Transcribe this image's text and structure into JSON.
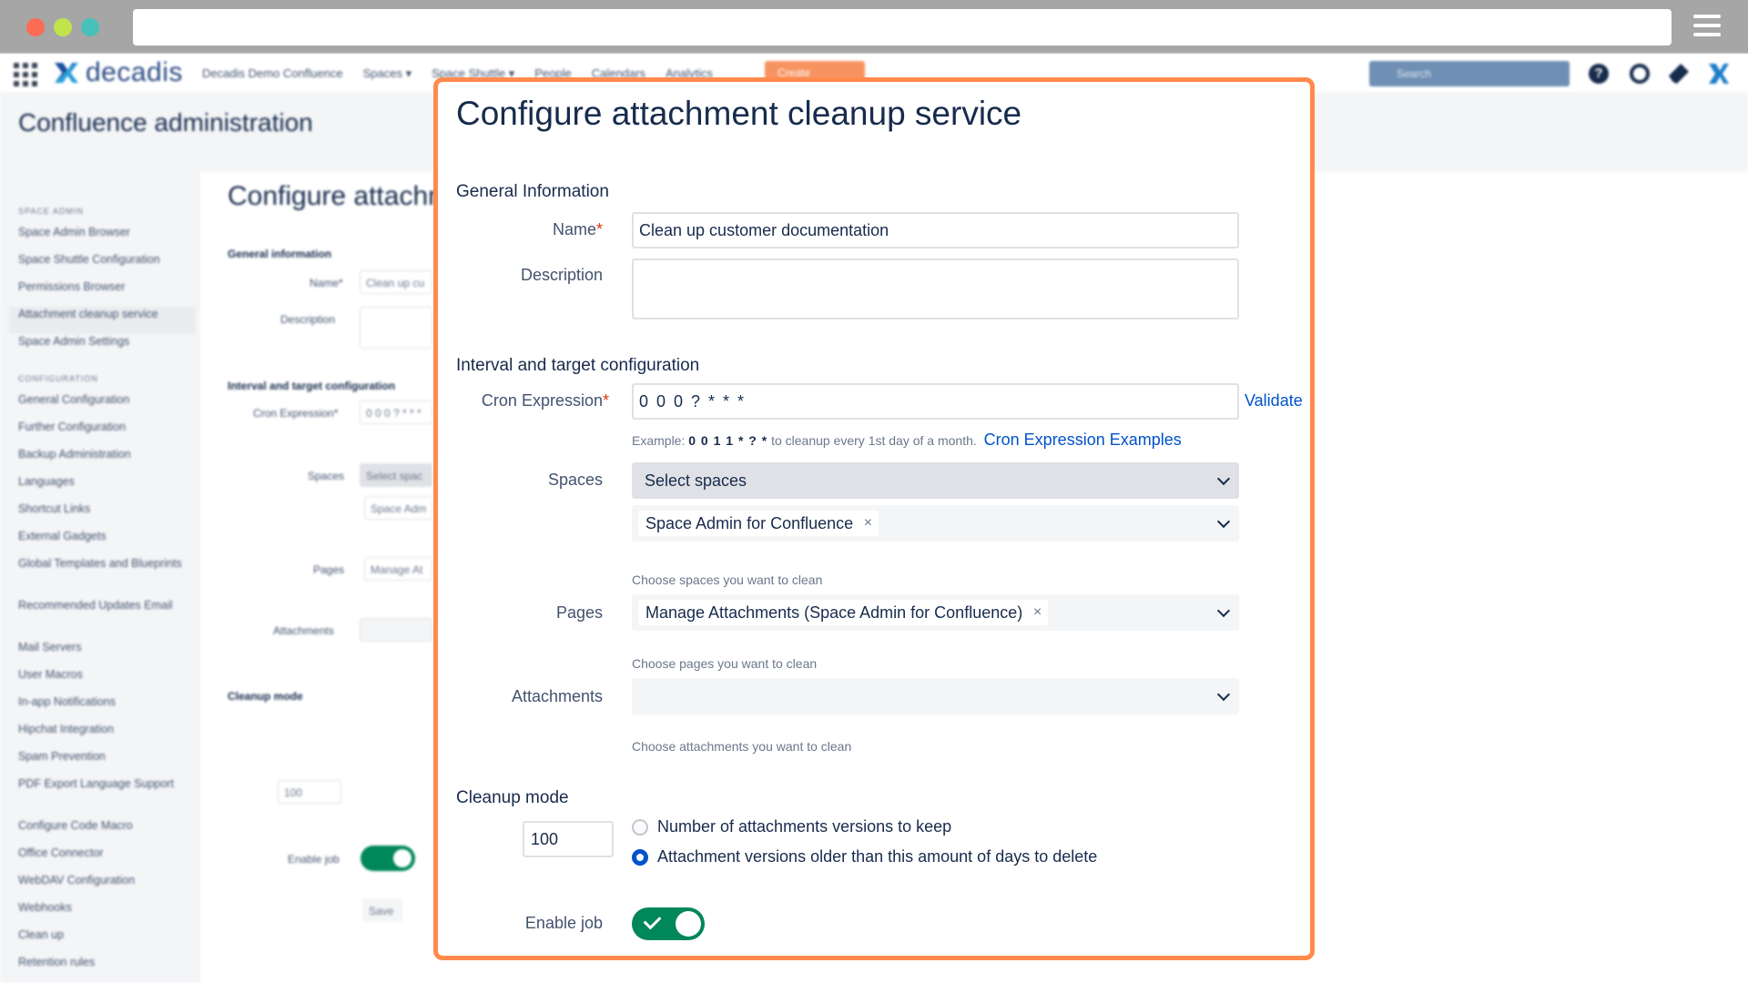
{
  "browser": {
    "url": ""
  },
  "app": {
    "logo_text": "decadis",
    "nav": [
      "Decadis Demo Confluence",
      "Spaces ▾",
      "Space Shuttle ▾",
      "People",
      "Calendars",
      "Analytics"
    ],
    "create_label": "Create",
    "search_placeholder": "Search",
    "help_glyph": "?",
    "admin_title": "Confluence administration"
  },
  "sidebar": {
    "section_space_admin": "SPACE ADMIN",
    "space_admin_items": [
      "Space Admin Browser",
      "Space Shuttle Configuration",
      "Permissions Browser",
      "Attachment cleanup service",
      "Space Admin Settings"
    ],
    "section_configuration": "CONFIGURATION",
    "configuration_items": [
      "General Configuration",
      "Further Configuration",
      "Backup Administration",
      "Languages",
      "Shortcut Links",
      "External Gadgets",
      "Global Templates and Blueprints",
      "Recommended Updates Email",
      "Mail Servers",
      "User Macros",
      "In-app Notifications",
      "Hipchat Integration",
      "Spam Prevention",
      "PDF Export Language Support",
      "Configure Code Macro",
      "Office Connector",
      "WebDAV Configuration",
      "Webhooks",
      "Clean up",
      "Retention rules"
    ]
  },
  "background_content": {
    "heading": "Configure attachm",
    "general_info": "General information",
    "name_label": "Name*",
    "name_value": "Clean up cu",
    "description_label": "Description",
    "interval_title": "Interval and target configuration",
    "cron_label": "Cron Expression*",
    "cron_value": "0 0 0 ? * * *",
    "spaces_label": "Spaces",
    "spaces_value": "Select spac",
    "space_tag": "Space Adm",
    "pages_label": "Pages",
    "pages_value": "Manage At",
    "attachments_label": "Attachments",
    "cleanup_title": "Cleanup mode",
    "cleanup_value": "100",
    "enable_label": "Enable job",
    "save_label": "Save"
  },
  "dialog": {
    "title": "Configure attachment cleanup service",
    "general_information": "General Information",
    "name_label": "Name",
    "required_mark": "*",
    "name_value": "Clean up customer documentation",
    "description_label": "Description",
    "description_value": "",
    "interval_title": "Interval and target configuration",
    "cron_label": "Cron Expression",
    "cron_value": "0 0 0 ? * * *",
    "validate_label": "Validate",
    "example_prefix": "Example: ",
    "example_expr": "0 0 1 1 * ? *",
    "example_suffix": " to cleanup every 1st day of a month.",
    "examples_link": "Cron Expression Examples",
    "spaces_label": "Spaces",
    "spaces_placeholder": "Select spaces",
    "space_tag": "Space Admin for Confluence",
    "spaces_hint": "Choose spaces you want to clean",
    "pages_label": "Pages",
    "page_tag": "Manage Attachments (Space Admin for Confluence)",
    "pages_hint": "Choose pages you want to clean",
    "attachments_label": "Attachments",
    "attachments_hint": "Choose attachments you want to clean",
    "cleanup_title": "Cleanup mode",
    "cleanup_value": "100",
    "radio_versions": "Number of attachments versions to keep",
    "radio_days": "Attachment versions older than this amount of days to delete",
    "radio_selected": "radio_days",
    "enable_label": "Enable job",
    "enable_on": true,
    "tag_remove_glyph": "×"
  },
  "colors": {
    "highlight_border": "#ff8a4c",
    "link": "#0052cc",
    "toggle_on": "#00875a",
    "required": "#de350b"
  }
}
